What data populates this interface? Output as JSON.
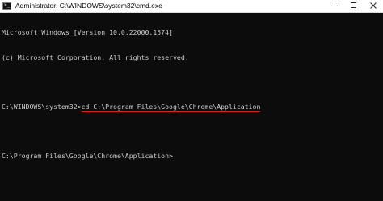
{
  "window": {
    "title": "Administrator: C:\\WINDOWS\\system32\\cmd.exe",
    "app_icon": "cmd-prompt-icon",
    "controls": {
      "minimize": "minimize-icon",
      "maximize": "maximize-icon",
      "close": "close-icon"
    }
  },
  "console": {
    "version_line": "Microsoft Windows [Version 10.0.22000.1574]",
    "copyright_line": "(c) Microsoft Corporation. All rights reserved.",
    "prompt1": "C:\\WINDOWS\\system32>",
    "command1": "cd C:\\Program Files\\Google\\Chrome\\Application",
    "prompt2": "C:\\Program Files\\Google\\Chrome\\Application>"
  },
  "colors": {
    "console_background": "#0c0c0c",
    "console_text": "#cccccc",
    "title_bar": "#ffffff",
    "highlight_underline": "#d81e1e"
  }
}
